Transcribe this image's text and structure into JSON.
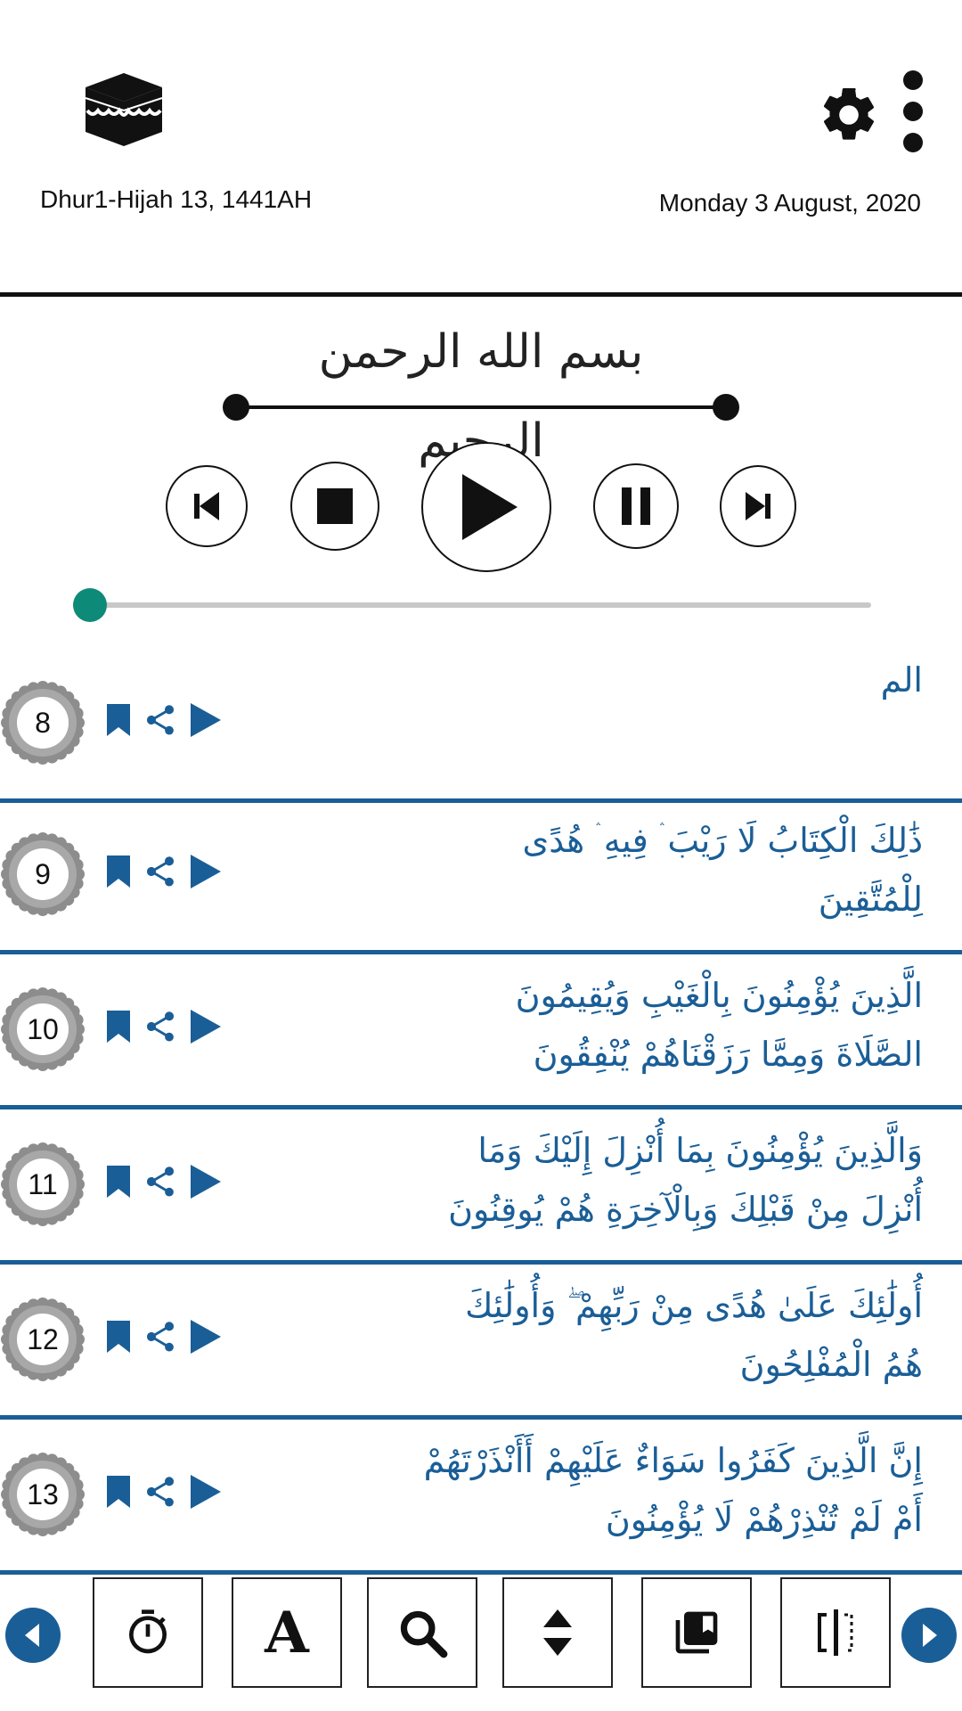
{
  "header": {
    "hijri_date": "Dhur1-Hijah 13, 1441AH",
    "gregorian_date": "Monday 3 August, 2020",
    "icons": [
      "kaaba-icon",
      "gear-icon",
      "more-vertical-icon"
    ]
  },
  "bismillah": {
    "text": "بسم الله الرحمن الرحيم"
  },
  "player": {
    "buttons": [
      "skip-previous",
      "stop",
      "play",
      "pause",
      "skip-next"
    ],
    "progress": 0
  },
  "verses": [
    {
      "number": "8",
      "line1": "الم",
      "line2": ""
    },
    {
      "number": "9",
      "line1": "ذَٰلِكَ الْكِتَابُ لَا رَيْبَ ۛ فِيهِ ۛ هُدًى",
      "line2": "لِلْمُتَّقِينَ"
    },
    {
      "number": "10",
      "line1": "الَّذِينَ يُؤْمِنُونَ بِالْغَيْبِ وَيُقِيمُونَ",
      "line2": "الصَّلَاةَ وَمِمَّا رَزَقْنَاهُمْ يُنْفِقُونَ"
    },
    {
      "number": "11",
      "line1": "وَالَّذِينَ يُؤْمِنُونَ بِمَا أُنْزِلَ إِلَيْكَ وَمَا",
      "line2": "أُنْزِلَ مِنْ قَبْلِكَ وَبِالْآخِرَةِ هُمْ يُوقِنُونَ"
    },
    {
      "number": "12",
      "line1": "أُولَٰئِكَ عَلَىٰ هُدًى مِنْ رَبِّهِمْ ۖ وَأُولَٰئِكَ",
      "line2": "هُمُ الْمُفْلِحُونَ"
    },
    {
      "number": "13",
      "line1": "إِنَّ الَّذِينَ كَفَرُوا سَوَاءٌ عَلَيْهِمْ أَأَنْذَرْتَهُمْ",
      "line2": "أَمْ لَمْ تُنْذِرْهُمْ لَا يُؤْمِنُونَ"
    }
  ],
  "toolbar": {
    "font_button_label": "A",
    "tools": [
      "timer-icon",
      "font-icon",
      "search-icon",
      "sort-icon",
      "library-icon",
      "split-view-icon"
    ]
  },
  "colors": {
    "accent": "#1a5e97",
    "seek_thumb": "#0e8a78"
  }
}
